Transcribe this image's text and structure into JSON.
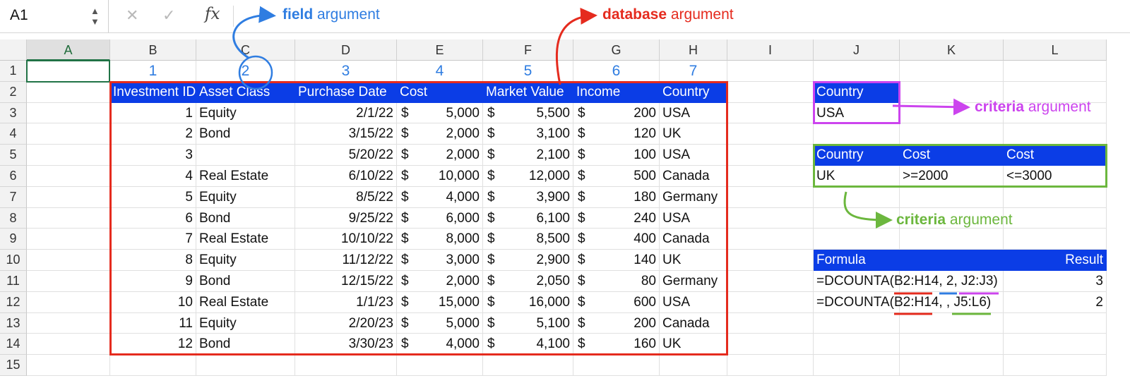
{
  "formula_bar": {
    "name_box": "A1",
    "cancel_icon": "✕",
    "enter_icon": "✓",
    "fx_label": "fx",
    "content": ""
  },
  "columns": [
    "A",
    "B",
    "C",
    "D",
    "E",
    "F",
    "G",
    "H",
    "I",
    "J",
    "K",
    "L"
  ],
  "rows": [
    "1",
    "2",
    "3",
    "4",
    "5",
    "6",
    "7",
    "8",
    "9",
    "10",
    "11",
    "12",
    "13",
    "14",
    "15"
  ],
  "field_numbers": [
    "1",
    "2",
    "3",
    "4",
    "5",
    "6",
    "7"
  ],
  "table": {
    "headers": [
      "Investment ID",
      "Asset Class",
      "Purchase Date",
      "Cost",
      "Market Value",
      "Income",
      "Country"
    ],
    "rows": [
      [
        "1",
        "Equity",
        "2/1/22",
        "5,000",
        "5,500",
        "200",
        "USA"
      ],
      [
        "2",
        "Bond",
        "3/15/22",
        "2,000",
        "3,100",
        "120",
        "UK"
      ],
      [
        "3",
        "",
        "5/20/22",
        "2,000",
        "2,100",
        "100",
        "USA"
      ],
      [
        "4",
        "Real Estate",
        "6/10/22",
        "10,000",
        "12,000",
        "500",
        "Canada"
      ],
      [
        "5",
        "Equity",
        "8/5/22",
        "4,000",
        "3,900",
        "180",
        "Germany"
      ],
      [
        "6",
        "Bond",
        "9/25/22",
        "6,000",
        "6,100",
        "240",
        "USA"
      ],
      [
        "7",
        "Real Estate",
        "10/10/22",
        "8,000",
        "8,500",
        "400",
        "Canada"
      ],
      [
        "8",
        "Equity",
        "11/12/22",
        "3,000",
        "2,900",
        "140",
        "UK"
      ],
      [
        "9",
        "Bond",
        "12/15/22",
        "2,000",
        "2,050",
        "80",
        "Germany"
      ],
      [
        "10",
        "Real Estate",
        "1/1/23",
        "15,000",
        "16,000",
        "600",
        "USA"
      ],
      [
        "11",
        "Equity",
        "2/20/23",
        "5,000",
        "5,100",
        "200",
        "Canada"
      ],
      [
        "12",
        "Bond",
        "3/30/23",
        "4,000",
        "4,100",
        "160",
        "UK"
      ]
    ],
    "currency": "$"
  },
  "criteria1": {
    "header": "Country",
    "value": "USA"
  },
  "criteria2": {
    "headers": [
      "Country",
      "Cost",
      "Cost"
    ],
    "values": [
      "UK",
      ">=2000",
      "<=3000"
    ]
  },
  "results": {
    "formula_header": "Formula",
    "result_header": "Result",
    "rows": [
      {
        "formula": "=DCOUNTA(B2:H14, 2, J2:J3)",
        "result": "3"
      },
      {
        "formula": "=DCOUNTA(B2:H14, , J5:L6)",
        "result": "2"
      }
    ]
  },
  "annotations": {
    "field": {
      "bold": "field",
      "rest": " argument",
      "color": "#2f7de1"
    },
    "database": {
      "bold": "database",
      "rest": " argument",
      "color": "#e52b1e"
    },
    "criteria1": {
      "bold": "criteria",
      "rest": " argument",
      "color": "#cc44ee"
    },
    "criteria2": {
      "bold": "criteria",
      "rest": " argument",
      "color": "#6cb73e"
    }
  },
  "colors": {
    "header_fill": "#0b3de6",
    "database": "#e52b1e",
    "field": "#2f7de1",
    "criteria1": "#cc44ee",
    "criteria2": "#6cb73e",
    "selection": "#217346"
  }
}
